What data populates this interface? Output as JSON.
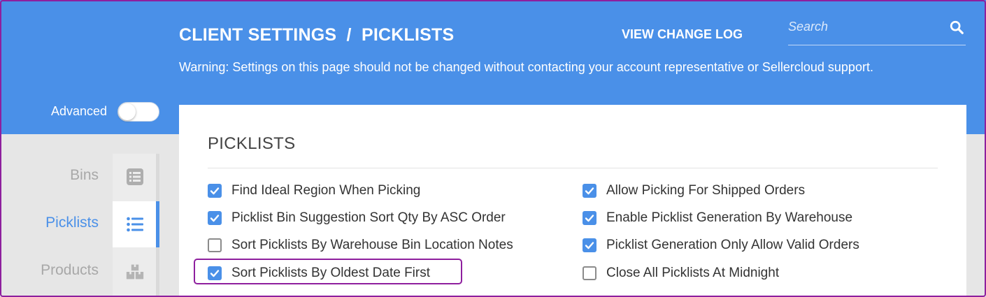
{
  "header": {
    "title": "CLIENT SETTINGS  /  PICKLISTS",
    "view_change_log": "VIEW CHANGE LOG",
    "search_placeholder": "Search",
    "warning": "Warning: Settings on this page should not be changed without contacting your account representative or Sellercloud support."
  },
  "advanced": {
    "label": "Advanced",
    "enabled": false
  },
  "sidebar": {
    "items": [
      {
        "label": "Bins",
        "icon": "list-box-icon",
        "active": false
      },
      {
        "label": "Picklists",
        "icon": "bulleted-list-icon",
        "active": true
      },
      {
        "label": "Products",
        "icon": "boxes-icon",
        "active": false
      }
    ]
  },
  "panel": {
    "title": "PICKLISTS",
    "left_options": [
      {
        "label": "Find Ideal Region When Picking",
        "checked": true
      },
      {
        "label": "Picklist Bin Suggestion Sort Qty By ASC Order",
        "checked": true
      },
      {
        "label": "Sort Picklists By Warehouse Bin Location Notes",
        "checked": false
      },
      {
        "label": "Sort Picklists By Oldest Date First",
        "checked": true
      }
    ],
    "right_options": [
      {
        "label": "Allow Picking For Shipped Orders",
        "checked": true
      },
      {
        "label": "Enable Picklist Generation By Warehouse",
        "checked": true
      },
      {
        "label": "Picklist Generation Only Allow Valid Orders",
        "checked": true
      },
      {
        "label": "Close All Picklists At Midnight",
        "checked": false
      }
    ]
  },
  "colors": {
    "brand": "#4a90e8",
    "highlight": "#8e1f9e"
  }
}
